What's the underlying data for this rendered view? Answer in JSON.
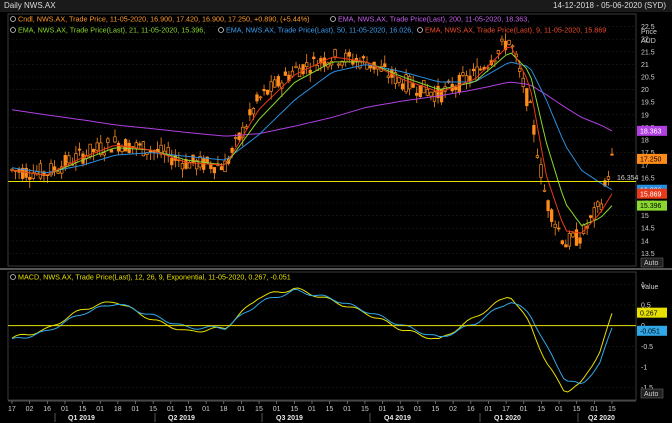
{
  "header": {
    "title": "Daily NWS.AX",
    "date_range": "14-12-2018 - 05-06-2020 (SYD)"
  },
  "legend": {
    "candle": "Cndl, NWS.AX, Trade Price, 11-05-2020, 16.900, 17.420, 16.900, 17.250, +0.890, (+5.44%)",
    "ema200": "EMA, NWS.AX, Trade Price(Last), 200, 11-05-2020, 18.363,",
    "ema21": "EMA, NWS.AX, Trade Price(Last), 21, 11-05-2020, 15.396,",
    "ema50": "EMA, NWS.AX, Trade Price(Last), 50, 11-05-2020, 16.026,",
    "ema9": "EMA, NWS.AX, Trade Price(Last), 9, 11-05-2020, 15.869",
    "macd": "MACD, NWS.AX, Trade Price(Last), 12, 26, 9, Exponential, 11-05-2020, 0.267, -0.051"
  },
  "price_axis": {
    "label_top": "Price",
    "label_unit": "AUD",
    "ticks": [
      "22.5",
      "22",
      "21.5",
      "21",
      "20.5",
      "20",
      "19.5",
      "19",
      "18.5",
      "18",
      "17.5",
      "17",
      "16.5",
      "16",
      "15.5",
      "15",
      "14.5",
      "14",
      "13.5"
    ],
    "auto": "Auto"
  },
  "macd_axis": {
    "label": "Value",
    "ticks": [
      "1",
      "0.5",
      "0",
      "-0.5",
      "-1",
      "-1.5"
    ],
    "auto": "Auto"
  },
  "badges": {
    "ema200": "18.363",
    "last": "17.250",
    "ema50": "16.026",
    "ema9": "15.869",
    "ema21": "15.396",
    "hline": "16.354",
    "macd": "0.267",
    "signal": "-0.051"
  },
  "x_axis": {
    "day_ticks": [
      "17",
      "02",
      "16",
      "01",
      "15",
      "01",
      "18",
      "01",
      "15",
      "01",
      "15",
      "01",
      "18",
      "01",
      "15",
      "01",
      "15",
      "01",
      "15",
      "01",
      "15",
      "01",
      "15",
      "01",
      "15",
      "02",
      "16",
      "01",
      "17",
      "01",
      "15",
      "01",
      "15",
      "01",
      "15"
    ],
    "quarters": [
      "Q1 2019",
      "Q2 2019",
      "Q3 2019",
      "Q4 2019",
      "Q1 2020",
      "Q2 2020"
    ]
  },
  "colors": {
    "candle": "#ff8c1a",
    "ema200": "#b040e0",
    "ema50": "#2a8ee0",
    "ema21": "#8ad830",
    "ema9": "#e83a1a",
    "hline": "#e8e000",
    "macd": "#e8e000",
    "signal": "#30a8e8",
    "badge_ema200": "#b040e0",
    "badge_last": "#ff8c1a",
    "badge_ema50": "#2a8ee0",
    "badge_ema9": "#e83a1a",
    "badge_ema21": "#8ad830",
    "badge_macd": "#e8e000",
    "badge_signal": "#30a8e8"
  },
  "chart_data": [
    {
      "type": "line",
      "title": "Daily NWS.AX",
      "ylabel": "Price AUD",
      "ylim": [
        13.0,
        23.0
      ],
      "hline": 16.354,
      "x": [
        "2018-12-17",
        "2019-01-15",
        "2019-02-15",
        "2019-03-15",
        "2019-04-15",
        "2019-05-15",
        "2019-06-17",
        "2019-07-15",
        "2019-08-15",
        "2019-09-16",
        "2019-10-15",
        "2019-11-15",
        "2019-12-16",
        "2020-01-15",
        "2020-02-14",
        "2020-03-02",
        "2020-03-16",
        "2020-04-01",
        "2020-04-15",
        "2020-05-01",
        "2020-05-11"
      ],
      "series": [
        {
          "name": "Cndl",
          "values": [
            16.8,
            16.7,
            17.4,
            17.9,
            17.6,
            17.1,
            17.0,
            19.6,
            20.8,
            21.3,
            21.1,
            20.3,
            19.8,
            20.6,
            22.0,
            19.3,
            15.6,
            13.9,
            14.2,
            15.4,
            17.25
          ]
        },
        {
          "name": "EMA 200",
          "values": [
            19.2,
            19.0,
            18.8,
            18.6,
            18.45,
            18.3,
            18.15,
            18.25,
            18.55,
            18.9,
            19.3,
            19.55,
            19.75,
            20.0,
            20.3,
            20.2,
            19.8,
            19.3,
            18.9,
            18.6,
            18.363
          ]
        },
        {
          "name": "EMA 50",
          "values": [
            16.9,
            16.7,
            17.0,
            17.4,
            17.5,
            17.35,
            17.2,
            18.2,
            19.6,
            20.7,
            21.0,
            20.7,
            20.3,
            20.3,
            21.1,
            20.9,
            19.6,
            17.8,
            16.8,
            16.3,
            16.026
          ]
        },
        {
          "name": "EMA 21",
          "values": [
            16.8,
            16.6,
            17.2,
            17.7,
            17.6,
            17.2,
            17.0,
            18.8,
            20.3,
            21.1,
            21.1,
            20.5,
            20.0,
            20.3,
            21.5,
            20.7,
            17.9,
            15.5,
            14.6,
            14.9,
            15.396
          ]
        },
        {
          "name": "EMA 9",
          "values": [
            16.8,
            16.6,
            17.3,
            17.8,
            17.6,
            17.1,
            17.0,
            19.2,
            20.6,
            21.3,
            21.1,
            20.4,
            19.9,
            20.4,
            21.8,
            20.2,
            16.6,
            14.4,
            14.3,
            15.1,
            15.869
          ]
        }
      ]
    },
    {
      "type": "line",
      "title": "MACD",
      "ylim": [
        -1.8,
        1.3
      ],
      "x": [
        "2018-12-17",
        "2019-01-15",
        "2019-02-15",
        "2019-03-15",
        "2019-04-15",
        "2019-05-15",
        "2019-06-17",
        "2019-07-15",
        "2019-08-15",
        "2019-09-16",
        "2019-10-15",
        "2019-11-15",
        "2019-12-16",
        "2020-01-15",
        "2020-02-14",
        "2020-03-02",
        "2020-03-16",
        "2020-04-01",
        "2020-04-15",
        "2020-05-01",
        "2020-05-11"
      ],
      "series": [
        {
          "name": "MACD",
          "values": [
            -0.3,
            -0.1,
            0.4,
            0.6,
            0.15,
            -0.15,
            -0.05,
            0.7,
            0.9,
            0.6,
            0.3,
            -0.1,
            -0.35,
            0.2,
            0.75,
            0.05,
            -0.9,
            -1.6,
            -1.4,
            -0.6,
            0.267
          ]
        },
        {
          "name": "Signal",
          "values": [
            -0.35,
            -0.15,
            0.3,
            0.55,
            0.25,
            -0.05,
            -0.05,
            0.55,
            0.85,
            0.65,
            0.35,
            0.0,
            -0.3,
            0.05,
            0.6,
            0.3,
            -0.5,
            -1.3,
            -1.45,
            -0.9,
            -0.051
          ]
        }
      ]
    }
  ]
}
